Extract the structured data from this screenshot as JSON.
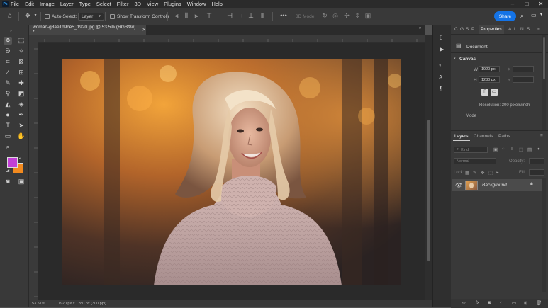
{
  "menu": {
    "items": [
      "File",
      "Edit",
      "Image",
      "Layer",
      "Type",
      "Select",
      "Filter",
      "3D",
      "View",
      "Plugins",
      "Window",
      "Help"
    ]
  },
  "options": {
    "auto_select_label": "Auto-Select:",
    "layer_dropdown": "Layer",
    "transform_label": "Show Transform Controls",
    "mode_3d": "3D Mode:",
    "share_label": "Share"
  },
  "document": {
    "tab_title": "woman-g8ae1d9ce5_1920.jpg @ 53.5% (RGB/8#) *",
    "zoom_status": "53.51%",
    "size_status": "1920 px x 1280 px (300 ppi)"
  },
  "properties": {
    "tabs": [
      "C",
      "G",
      "S",
      "P",
      "Properties",
      "A",
      "L",
      "N",
      "S"
    ],
    "document_label": "Document",
    "canvas_section": "Canvas",
    "width_label": "W",
    "width_value": "1920 px",
    "height_label": "H",
    "height_value": "1280 px",
    "x_label": "X",
    "y_label": "Y",
    "resolution": "Resolution: 300 pixels/inch",
    "mode_label": "Mode"
  },
  "layers": {
    "tabs": [
      "Layers",
      "Channels",
      "Paths"
    ],
    "filter_placeholder": "Kind",
    "blend_mode": "Normal",
    "opacity_label": "Opacity:",
    "lock_label": "Lock:",
    "fill_label": "Fill:",
    "layer_name": "Background"
  },
  "colors": {
    "foreground": "#c23fd6",
    "background": "#f28a1f",
    "accent": "#1473e6"
  }
}
